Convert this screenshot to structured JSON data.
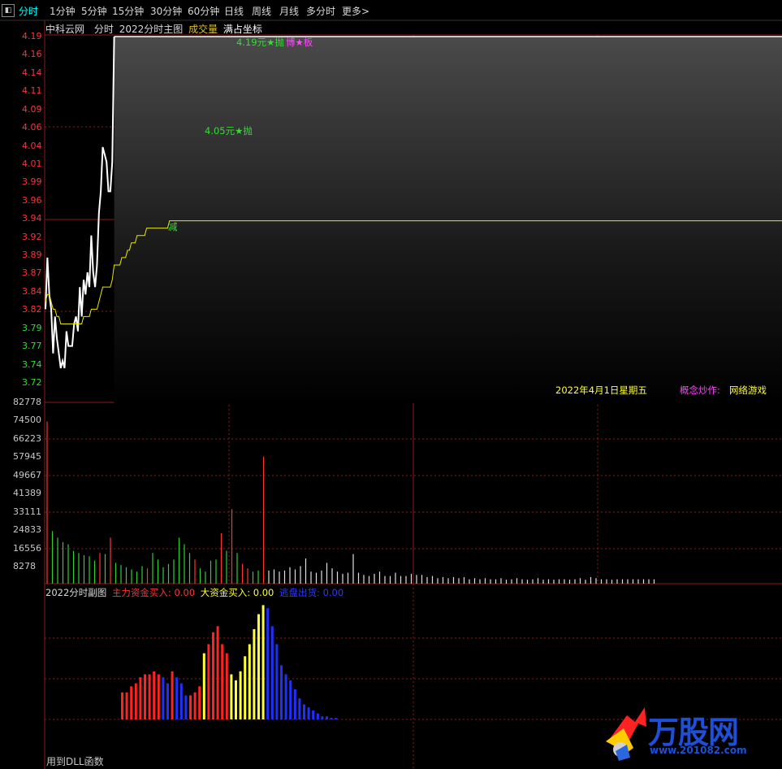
{
  "tabs": {
    "left_icon": "◧",
    "items": [
      {
        "label": "分时",
        "active": true
      },
      {
        "label": "1分钟"
      },
      {
        "label": "5分钟"
      },
      {
        "label": "15分钟"
      },
      {
        "label": "30分钟"
      },
      {
        "label": "60分钟"
      },
      {
        "label": "日线"
      },
      {
        "label": "周线"
      },
      {
        "label": "月线"
      },
      {
        "label": "多分时"
      },
      {
        "label": "更多"
      }
    ],
    "more_arrow": ">"
  },
  "main_chart": {
    "stock_name": "中科云网",
    "period": "分时",
    "indicator": "2022分时主图",
    "volume_label": "成交量",
    "coord_mode": "满占坐标",
    "price_axis": [
      "4.19",
      "4.16",
      "4.14",
      "4.11",
      "4.09",
      "4.06",
      "4.04",
      "4.01",
      "3.99",
      "3.96",
      "3.94",
      "3.92",
      "3.89",
      "3.87",
      "3.84",
      "3.82",
      "3.79",
      "3.77",
      "3.74",
      "3.72"
    ],
    "annotations": {
      "top_price": "4.19元★抛",
      "top_board": "博★板",
      "mid_price": "4.05元★抛",
      "reduce": "减"
    },
    "date_text": "2022年4月1日星期五",
    "concept_label": "概念炒作:",
    "concept_value": "网络游戏"
  },
  "volume_chart": {
    "axis": [
      "82778",
      "74500",
      "66223",
      "57945",
      "49667",
      "41389",
      "33111",
      "24833",
      "16556",
      "8278"
    ]
  },
  "sub_chart": {
    "title": "2022分时副图",
    "main_buy_label": "主力资金买入:",
    "main_buy_value": "0.00",
    "big_buy_label": "大资金买入:",
    "big_buy_value": "0.00",
    "escape_label": "逃盘出货:",
    "escape_value": "0.00"
  },
  "footer": {
    "dll_text": "用到DLL函数"
  },
  "logo": {
    "brand": "万股网",
    "url": "www.201082.com"
  },
  "colors": {
    "up": "#ff3333",
    "down": "#33cc33",
    "price_line": "#ffffff",
    "avg_line": "#e8e800",
    "grid": "#8b1a1a",
    "blue": "#1f2fff",
    "yellow": "#ffff33",
    "magenta": "#ff44ff",
    "cyan": "#00ffff"
  },
  "chart_data": [
    {
      "type": "line",
      "title": "2022分时主图",
      "ylim": [
        3.72,
        4.19
      ],
      "series": [
        {
          "values": [
            3.82,
            3.89,
            3.84,
            3.82,
            3.76,
            3.81,
            3.78,
            3.76,
            3.74,
            3.75,
            3.74,
            3.79,
            3.77,
            3.77,
            3.77,
            3.8,
            3.81,
            3.79,
            3.85,
            3.81,
            3.86,
            3.84,
            3.87,
            3.85,
            3.92,
            3.87,
            3.85,
            3.88,
            3.95,
            3.98,
            4.04,
            4.03,
            4.02,
            3.98,
            3.98,
            4.02,
            4.19,
            4.19,
            4.19,
            4.19,
            4.19,
            4.19,
            4.19,
            4.19,
            4.19,
            4.19,
            4.19,
            4.19,
            4.19,
            4.19,
            4.19,
            4.19,
            4.19,
            4.19,
            4.19,
            4.19,
            4.19,
            4.19,
            4.19,
            4.19,
            4.19,
            4.19,
            4.19,
            4.19,
            4.19,
            4.19,
            4.19,
            4.19,
            4.19,
            4.19,
            4.19,
            4.19,
            4.19,
            4.19,
            4.19,
            4.19,
            4.19,
            4.19,
            4.19,
            4.19,
            4.19,
            4.19,
            4.19,
            4.19,
            4.19,
            4.19,
            4.19,
            4.19,
            4.19,
            4.19,
            4.19,
            4.19,
            4.19,
            4.19,
            4.19,
            4.19,
            4.19,
            4.19,
            4.19,
            4.19,
            4.19,
            4.19,
            4.19,
            4.19,
            4.19,
            4.19,
            4.19,
            4.19,
            4.19,
            4.19,
            4.19,
            4.19,
            4.19,
            4.19,
            4.19,
            4.19,
            4.19,
            4.19,
            4.19,
            4.19
          ]
        },
        {
          "values": [
            3.83,
            3.84,
            3.84,
            3.83,
            3.82,
            3.82,
            3.81,
            3.81,
            3.8,
            3.8,
            3.8,
            3.8,
            3.8,
            3.8,
            3.8,
            3.8,
            3.8,
            3.8,
            3.8,
            3.8,
            3.81,
            3.81,
            3.81,
            3.81,
            3.82,
            3.82,
            3.82,
            3.82,
            3.83,
            3.84,
            3.85,
            3.85,
            3.85,
            3.85,
            3.85,
            3.86,
            3.88,
            3.88,
            3.88,
            3.88,
            3.89,
            3.89,
            3.89,
            3.9,
            3.9,
            3.91,
            3.91,
            3.91,
            3.92,
            3.92,
            3.92,
            3.92,
            3.92,
            3.93,
            3.93,
            3.93,
            3.93,
            3.93,
            3.93,
            3.93,
            3.93,
            3.93,
            3.93,
            3.93,
            3.93,
            3.94,
            3.94,
            3.94,
            3.94,
            3.94,
            3.94,
            3.94,
            3.94,
            3.94,
            3.94,
            3.94,
            3.94,
            3.94,
            3.94,
            3.94,
            3.94,
            3.94,
            3.94,
            3.94,
            3.94,
            3.94,
            3.94,
            3.94,
            3.94,
            3.94,
            3.94,
            3.94,
            3.94,
            3.94,
            3.94,
            3.94,
            3.94,
            3.94,
            3.94,
            3.94,
            3.94,
            3.94,
            3.94,
            3.94,
            3.94,
            3.94,
            3.94,
            3.94,
            3.94,
            3.94,
            3.94,
            3.94,
            3.94,
            3.94,
            3.94,
            3.94,
            3.94,
            3.94,
            3.94,
            3.94
          ]
        }
      ]
    },
    {
      "type": "bar",
      "ylim": [
        0,
        82778
      ],
      "values": [
        74000,
        24000,
        21000,
        19000,
        18000,
        15000,
        14000,
        13000,
        12500,
        10500,
        14000,
        13500,
        21000,
        9500,
        8500,
        7500,
        6500,
        5500,
        8000,
        7000,
        14000,
        11000,
        7500,
        9000,
        11000,
        21000,
        18000,
        14000,
        11000,
        7000,
        5500,
        10500,
        11000,
        23000,
        15000,
        34000,
        14000,
        9000,
        7000,
        5500,
        6000,
        58000,
        6000,
        6500,
        5500,
        6000,
        7500,
        6500,
        8000,
        11500,
        5500,
        5000,
        6000,
        9500,
        7000,
        5500,
        4500,
        5000,
        13500,
        5000,
        4000,
        3500,
        4500,
        5500,
        3500,
        3500,
        5000,
        3500,
        3500,
        4500,
        4000,
        4000,
        3000,
        3500,
        2500,
        3000,
        2500,
        3000,
        2500,
        3000,
        2000,
        2500,
        2000,
        2500,
        2000,
        2000,
        2500,
        1800,
        2000,
        2500,
        2000,
        1800,
        2000,
        2500,
        1800,
        2000,
        1800,
        2000,
        2000,
        1800,
        2000,
        2500,
        1800,
        3000,
        2500,
        2000,
        2000,
        1800,
        2000,
        2000,
        2000,
        2000,
        2000,
        2000,
        2000,
        2000,
        2000,
        2000,
        2000,
        2000
      ],
      "colors": [
        "up",
        "down",
        "down",
        "down",
        "down",
        "down",
        "down",
        "down",
        "down",
        "down",
        "up",
        "down",
        "up",
        "down",
        "down",
        "down",
        "down",
        "down",
        "down",
        "up",
        "down",
        "down",
        "down",
        "down",
        "down",
        "down",
        "down",
        "down",
        "up",
        "down",
        "down",
        "down",
        "down",
        "up",
        "down",
        "up",
        "down",
        "up",
        "up",
        "down",
        "down",
        "up",
        "white",
        "white",
        "white",
        "white",
        "white",
        "white",
        "white",
        "white",
        "white",
        "white",
        "white",
        "white",
        "white",
        "white",
        "white",
        "white",
        "white",
        "white",
        "white",
        "white",
        "white",
        "white",
        "white",
        "white",
        "white",
        "white",
        "white",
        "white",
        "white",
        "white",
        "white",
        "white",
        "white",
        "white",
        "white",
        "white",
        "white",
        "white",
        "white",
        "white",
        "white",
        "white",
        "white",
        "white",
        "white",
        "white",
        "white",
        "white",
        "white",
        "white",
        "white",
        "white",
        "white",
        "white",
        "white",
        "white",
        "white",
        "white",
        "white",
        "white",
        "white",
        "white",
        "white",
        "white",
        "white",
        "white",
        "white",
        "white",
        "white",
        "white",
        "white",
        "white",
        "white",
        "white"
      ]
    },
    {
      "type": "bar",
      "title": "2022分时副图",
      "values": [
        18,
        18,
        22,
        24,
        28,
        30,
        30,
        32,
        30,
        28,
        24,
        32,
        28,
        24,
        16,
        16,
        18,
        22,
        44,
        50,
        58,
        62,
        50,
        44,
        30,
        26,
        32,
        42,
        50,
        60,
        70,
        76,
        74,
        62,
        50,
        36,
        30,
        26,
        20,
        14,
        10,
        8,
        6,
        4,
        2,
        2,
        1,
        1
      ],
      "colors": [
        "red",
        "red",
        "red",
        "red",
        "red",
        "red",
        "red",
        "red",
        "red",
        "blue",
        "blue",
        "red",
        "blue",
        "blue",
        "blue",
        "red",
        "red",
        "red",
        "yellow",
        "red",
        "red",
        "red",
        "red",
        "red",
        "yellow",
        "yellow",
        "yellow",
        "yellow",
        "yellow",
        "yellow",
        "yellow",
        "yellow",
        "blue",
        "blue",
        "blue",
        "blue",
        "blue",
        "blue",
        "blue",
        "blue",
        "blue",
        "blue",
        "blue",
        "blue",
        "blue",
        "blue",
        "blue",
        "blue"
      ]
    }
  ]
}
